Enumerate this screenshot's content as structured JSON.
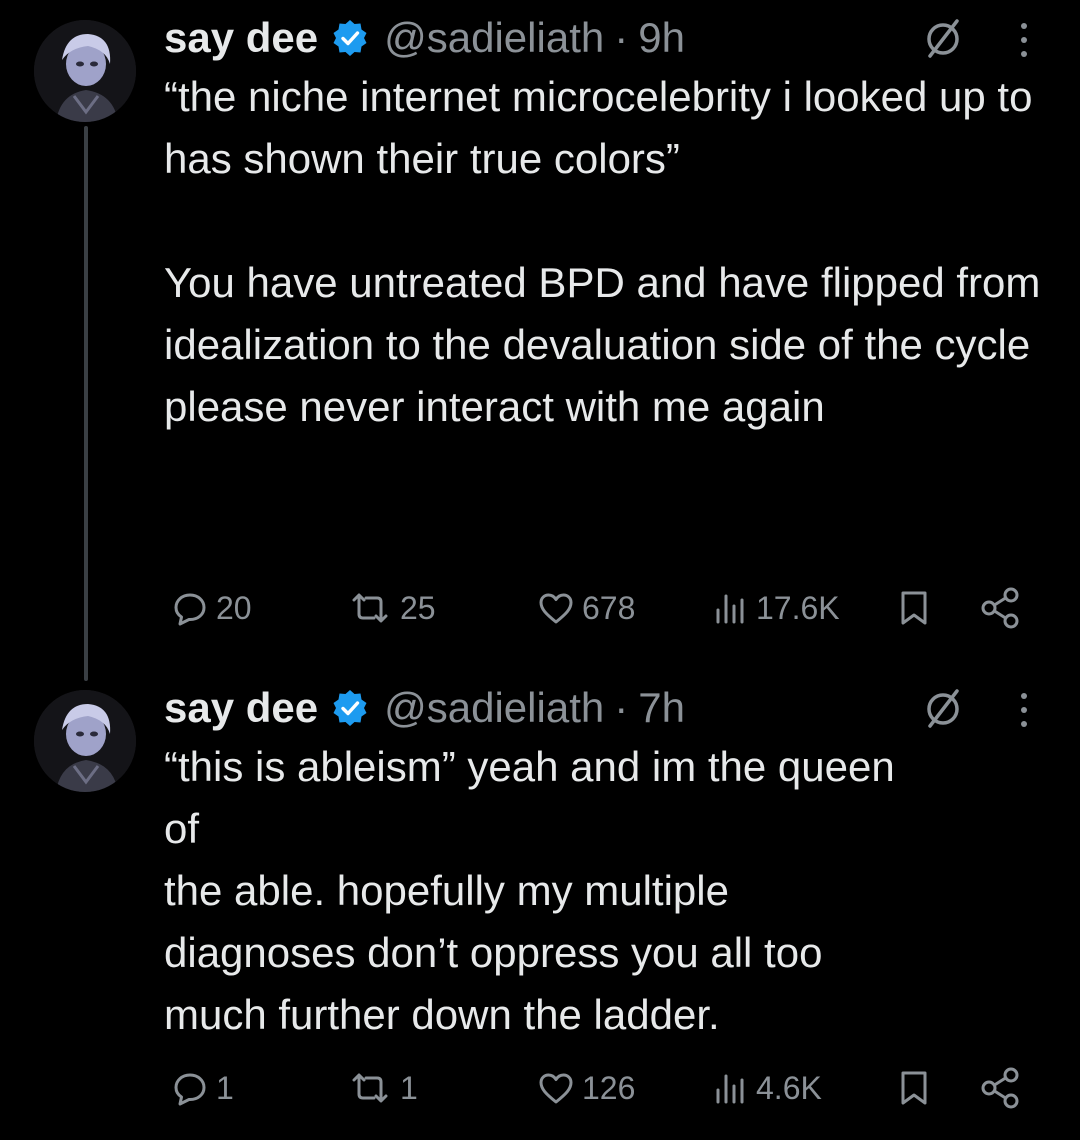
{
  "colors": {
    "background": "#000000",
    "text": "#e7e9ea",
    "secondary": "#8b9197",
    "verified": "#1d9bf0"
  },
  "tweets": [
    {
      "name": "say dee",
      "handle": "@sadieliath",
      "separator": "·",
      "time": "9h",
      "paragraphs": [
        "“the niche internet microcelebrity i looked up to has shown their true colors”",
        "You have untreated BPD and have flipped from idealization to the devaluation side of the cycle please never interact with me again"
      ],
      "stats": {
        "replies": "20",
        "reposts": "25",
        "likes": "678",
        "views": "17.6K"
      }
    },
    {
      "name": "say dee",
      "handle": "@sadieliath",
      "separator": "·",
      "time": "7h",
      "lines": [
        "“this is ableism” yeah and im the queen",
        "of",
        "the able. hopefully my multiple",
        "diagnoses don’t oppress you all too",
        "much further down the ladder."
      ],
      "stats": {
        "replies": "1",
        "reposts": "1",
        "likes": "126",
        "views": "4.6K"
      }
    }
  ],
  "icons": {
    "verified": "verified-badge-icon",
    "muted": "muted-circle-slash-icon",
    "more": "vertical-ellipsis-icon",
    "reply": "speech-bubble-icon",
    "repost": "repost-arrows-icon",
    "like": "heart-icon",
    "views": "bar-chart-icon",
    "bookmark": "bookmark-icon",
    "share": "share-nodes-icon"
  }
}
